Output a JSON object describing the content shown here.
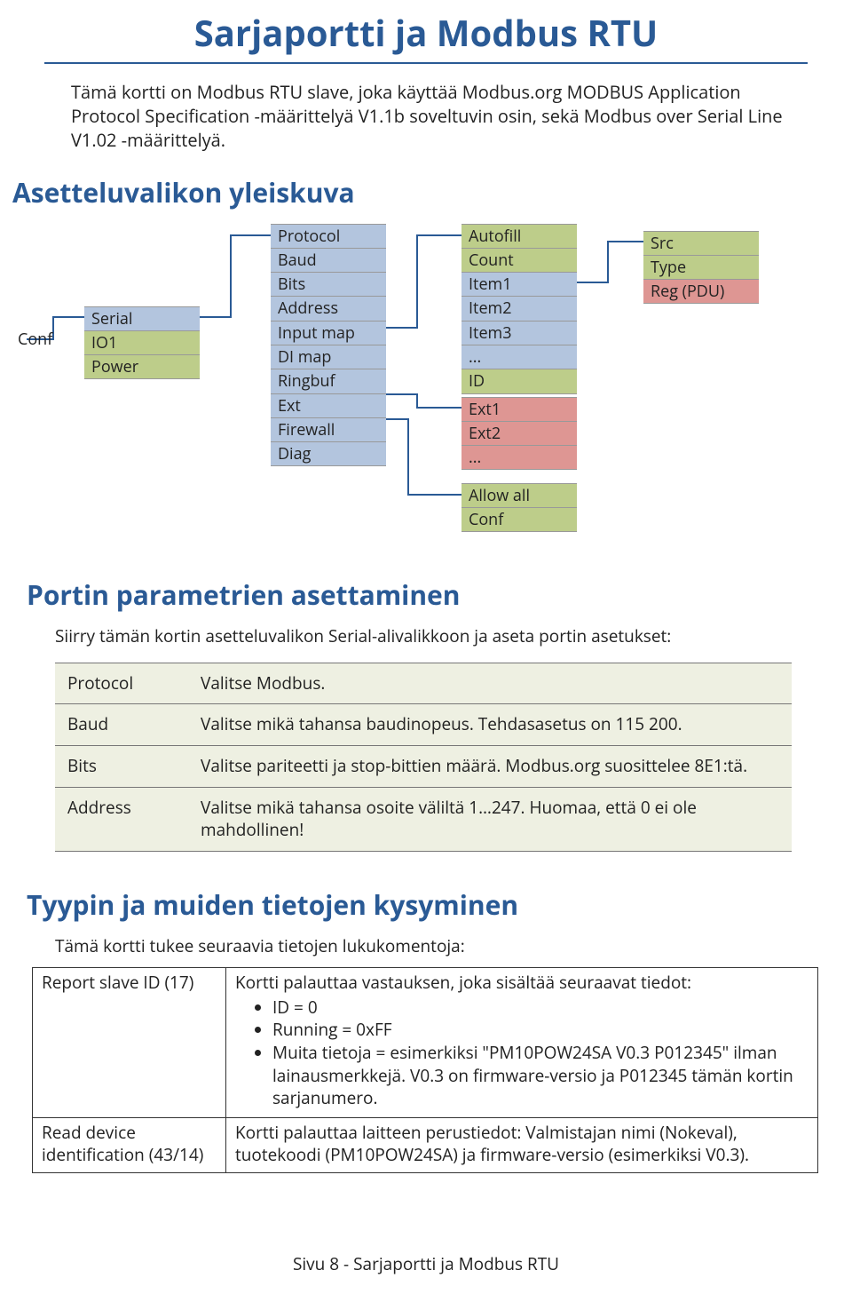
{
  "title": "Sarjaportti ja Modbus RTU",
  "intro": "Tämä kortti on Modbus RTU slave, joka käyttää Modbus.org MODBUS Application Protocol Specification -määrittelyä V1.1b soveltuvin osin, sekä Modbus over Serial Line V1.02 -määrittelyä.",
  "sections": {
    "overview_title": "Asetteluvalikon yleiskuva",
    "params_title": "Portin parametrien asettaminen",
    "params_intro": "Siirry tämän kortin asetteluvalikon Serial-alivalikkoon ja aseta portin asetukset:",
    "commands_title": "Tyypin ja muiden tietojen kysyminen",
    "commands_intro": "Tämä kortti tukee seuraavia tietojen lukukomentoja:"
  },
  "diagram": {
    "conf_label": "Conf",
    "col1": [
      "Serial",
      "IO1",
      "Power"
    ],
    "col2": [
      "Protocol",
      "Baud",
      "Bits",
      "Address",
      "Input map",
      "DI map",
      "Ringbuf",
      "Ext",
      "Firewall",
      "Diag"
    ],
    "col3a": [
      "Autofill",
      "Count",
      "Item1",
      "Item2",
      "Item3",
      "..."
    ],
    "col3a_id": "ID",
    "col3b": [
      "Ext1",
      "Ext2",
      "..."
    ],
    "col3c": [
      "Allow all",
      "Conf"
    ],
    "col4": [
      "Src",
      "Type",
      "Reg (PDU)"
    ]
  },
  "params": [
    {
      "name": "Protocol",
      "desc": "Valitse Modbus."
    },
    {
      "name": "Baud",
      "desc": "Valitse mikä tahansa baudinopeus. Tehdasasetus on 115 200."
    },
    {
      "name": "Bits",
      "desc": "Valitse pariteetti ja stop-bittien määrä. Modbus.org suosittelee 8E1:tä."
    },
    {
      "name": "Address",
      "desc": "Valitse mikä tahansa osoite väliltä 1…247. Huomaa, että 0 ei ole mahdollinen!"
    }
  ],
  "commands": [
    {
      "name": "Report slave ID (17)",
      "desc": "Kortti palauttaa vastauksen, joka sisältää seuraavat tiedot:",
      "bullets": [
        "ID = 0",
        "Running = 0xFF",
        "Muita tietoja = esimerkiksi \"PM10POW24SA V0.3 P012345\" ilman lainausmerkkejä. V0.3 on firmware-versio ja P012345 tämän kortin sarjanumero."
      ]
    },
    {
      "name": "Read device identification (43/14)",
      "desc": "Kortti palauttaa laitteen perustiedot: Valmistajan nimi (Nokeval), tuotekoodi (PM10POW24SA) ja firmware-versio (esimerkiksi V0.3).",
      "bullets": []
    }
  ],
  "footer": "Sivu 8 - Sarjaportti ja Modbus RTU"
}
